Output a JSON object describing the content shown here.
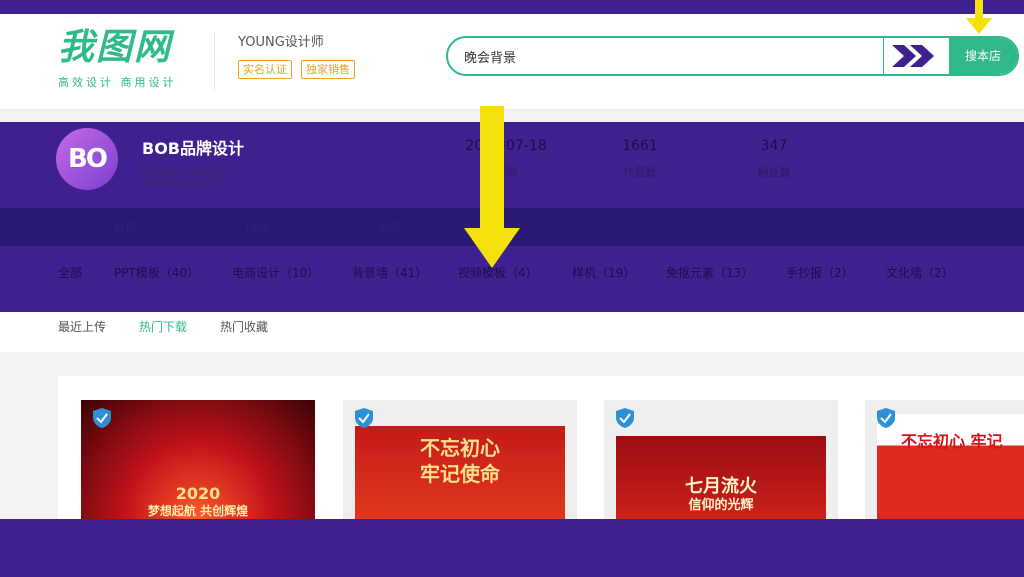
{
  "header": {
    "logo_main": "我图网",
    "logo_sub": "高效设计  商用设计",
    "designer_name": "YOUNG设计师",
    "badges": [
      "实名认证",
      "独家销售"
    ]
  },
  "search": {
    "value": "晚会背景",
    "button_label": "搜本店"
  },
  "store": {
    "avatar_text": "BO",
    "name": "BOB品牌设计",
    "tag": "我图网10年资深",
    "stats": [
      {
        "value": "2019-07-18",
        "label": "时间"
      },
      {
        "value": "1661",
        "label": "作品数"
      },
      {
        "value": "347",
        "label": "粉丝数"
      }
    ]
  },
  "nav": [
    "首页",
    "作品",
    "专辑"
  ],
  "categories": [
    "全部",
    "PPT模板（40）",
    "电商设计（10）",
    "背景墙（41）",
    "视频模板（4）",
    "样机（19）",
    "免抠元素（13）",
    "手抄报（2）",
    "文化墙（2）"
  ],
  "sort_tabs": [
    "最近上传",
    "热门下载",
    "热门收藏"
  ],
  "cards": [
    {
      "title": "2020",
      "subtitle": "梦想起航 共创辉煌"
    },
    {
      "title": "不忘初心",
      "subtitle": "牢记使命"
    },
    {
      "title": "七月流火",
      "subtitle": "信仰的光辉"
    },
    {
      "title": "不忘初心 牢记",
      "subtitle": ""
    }
  ],
  "colors": {
    "brand_green": "#2fb98d",
    "band_purple": "#3f208f",
    "arrow_yellow": "#f5e10a"
  },
  "icons": [
    "check-badge-icon",
    "double-chevron-icon",
    "down-arrow-icon"
  ]
}
